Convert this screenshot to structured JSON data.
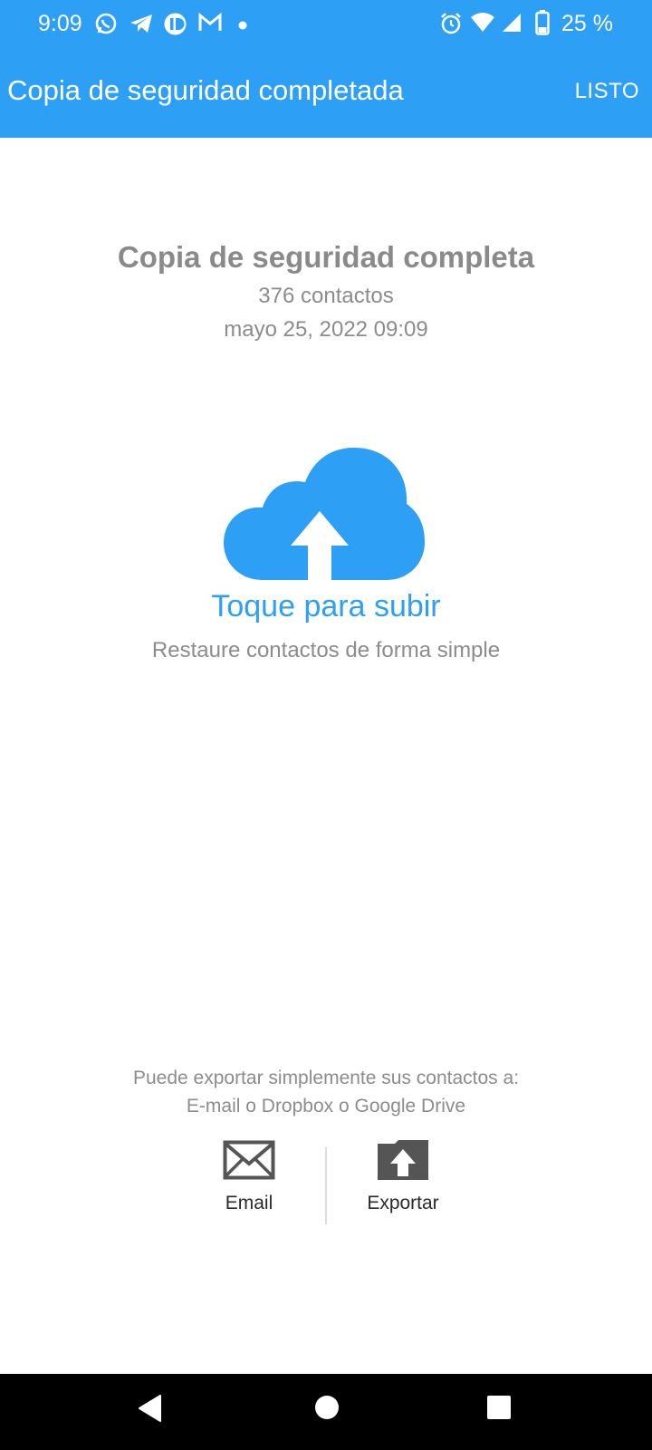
{
  "status_bar": {
    "time": "9:09",
    "battery": "25 %",
    "left_icons": [
      "whatsapp-icon",
      "telegram-icon",
      "app-icon",
      "gmail-icon",
      "notification-dot-icon"
    ],
    "right_icons": [
      "alarm-icon",
      "wifi-icon",
      "signal-icon",
      "battery-icon"
    ]
  },
  "app_bar": {
    "title": "Copia de seguridad completada",
    "done_label": "LISTO",
    "color": "#2d9ff5"
  },
  "summary": {
    "heading": "Copia de seguridad completa",
    "contacts": "376 contactos",
    "date": "mayo 25, 2022 09:09"
  },
  "upload": {
    "icon": "cloud-upload-icon",
    "label": "Toque para subir",
    "sublabel": "Restaure contactos de forma simple"
  },
  "export": {
    "note_line1": "Puede exportar simplemente sus contactos a:",
    "note_line2": "E-mail o Dropbox o Google Drive",
    "options": [
      {
        "label": "Email",
        "icon": "envelope-icon"
      },
      {
        "label": "Exportar",
        "icon": "folder-upload-icon"
      }
    ]
  },
  "nav_bar": {
    "buttons": [
      "back-icon",
      "home-icon",
      "recents-icon"
    ]
  }
}
